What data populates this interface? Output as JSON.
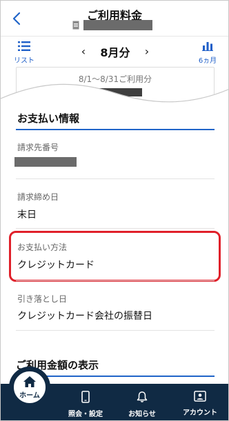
{
  "header": {
    "title": "ご利用料金",
    "account_redacted": true
  },
  "month_nav": {
    "list_label": "リスト",
    "prev": "‹",
    "month": "8月分",
    "next": "›",
    "six_months_label": "6ヵ月"
  },
  "preview": {
    "period_text": "8/1〜8/31ご利用分"
  },
  "payment_info": {
    "section_title": "お支払い情報",
    "billing_number_label": "請求先番号",
    "closing_date_label": "請求締め日",
    "closing_date_value": "末日",
    "payment_method_label": "お支払い方法",
    "payment_method_value": "クレジットカード",
    "withdrawal_label": "引き落とし日",
    "withdrawal_value": "クレジットカード会社の振替日"
  },
  "usage_display": {
    "section_title": "ご利用金額の表示"
  },
  "tabbar": {
    "home": "ホーム",
    "inquiry": "照会・設定",
    "notice": "お知らせ",
    "account": "アカウント"
  },
  "colors": {
    "accent": "#1f64c8",
    "tabbar": "#102a44",
    "highlight": "#e0202a"
  }
}
